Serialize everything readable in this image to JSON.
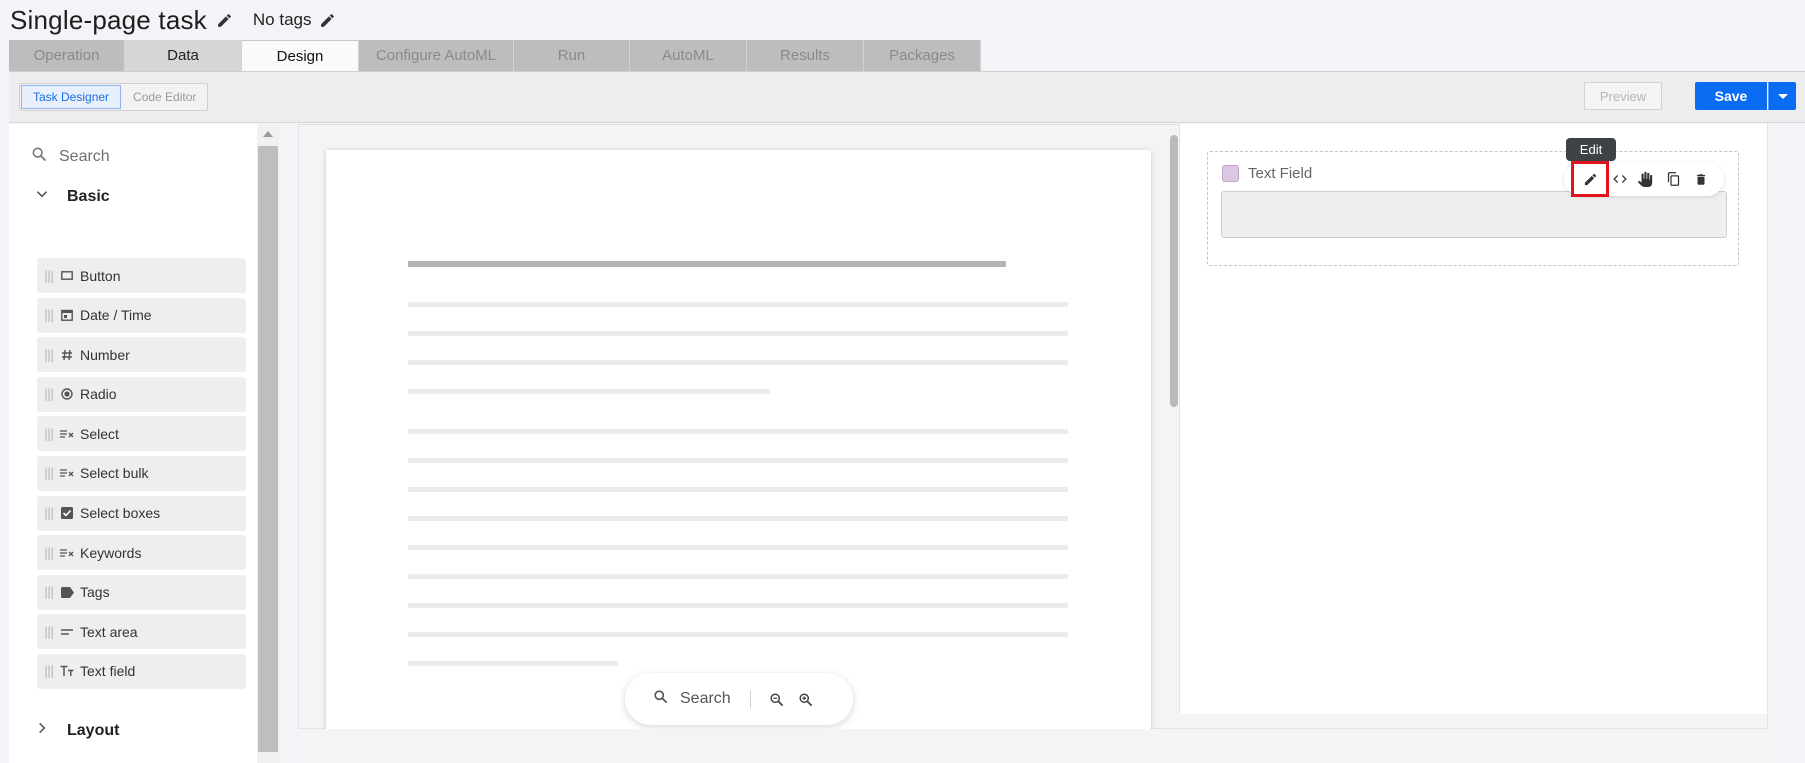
{
  "header": {
    "title": "Single-page task",
    "tags": "No tags"
  },
  "tabs": [
    {
      "label": "Operation"
    },
    {
      "label": "Data"
    },
    {
      "label": "Design"
    },
    {
      "label": "Configure AutoML"
    },
    {
      "label": "Run"
    },
    {
      "label": "AutoML"
    },
    {
      "label": "Results"
    },
    {
      "label": "Packages"
    }
  ],
  "toolbar": {
    "modes": [
      "Task Designer",
      "Code Editor"
    ],
    "active_mode": "Task Designer",
    "preview_label": "Preview",
    "save_label": "Save"
  },
  "sidebar": {
    "search_placeholder": "Search",
    "groups": [
      {
        "label": "Basic",
        "expanded": true
      },
      {
        "label": "Layout",
        "expanded": false
      }
    ],
    "items": [
      {
        "label": "Button",
        "icon": "button-icon"
      },
      {
        "label": "Date / Time",
        "icon": "calendar-icon"
      },
      {
        "label": "Number",
        "icon": "hash-icon"
      },
      {
        "label": "Radio",
        "icon": "radio-icon"
      },
      {
        "label": "Select",
        "icon": "select-list-icon"
      },
      {
        "label": "Select bulk",
        "icon": "select-list-icon"
      },
      {
        "label": "Select boxes",
        "icon": "checkbox-icon"
      },
      {
        "label": "Keywords",
        "icon": "select-list-icon"
      },
      {
        "label": "Tags",
        "icon": "tag-icon"
      },
      {
        "label": "Text area",
        "icon": "text-lines-icon"
      },
      {
        "label": "Text field",
        "icon": "text-format-icon"
      }
    ]
  },
  "document": {
    "search_placeholder": "Search"
  },
  "design": {
    "field_label": "Text Field",
    "tooltip": "Edit",
    "actions": [
      "edit-icon",
      "code-icon",
      "drag-hand-icon",
      "copy-icon",
      "delete-icon"
    ]
  },
  "colors": {
    "primary": "#0a6cf2",
    "highlight": "#e0141c",
    "tab_inactive": "#bdbdbd",
    "field_swatch": "#dcc7e3"
  }
}
